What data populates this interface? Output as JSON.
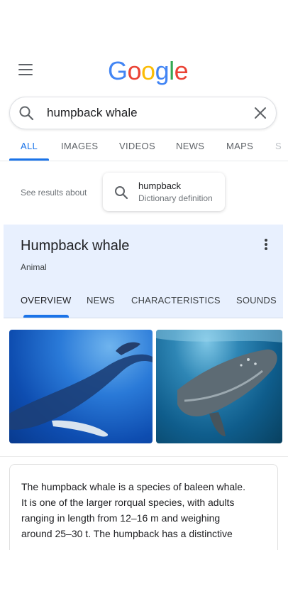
{
  "header": {
    "logo_letters": [
      {
        "char": "G",
        "color": "#4285F4"
      },
      {
        "char": "o",
        "color": "#EA4335"
      },
      {
        "char": "o",
        "color": "#FBBC05"
      },
      {
        "char": "g",
        "color": "#4285F4"
      },
      {
        "char": "l",
        "color": "#34A853"
      },
      {
        "char": "e",
        "color": "#EA4335"
      }
    ],
    "menu_icon": "hamburger-menu-icon"
  },
  "search": {
    "query": "humpback whale",
    "search_icon": "search-icon",
    "clear_icon": "close-icon"
  },
  "tabs": [
    {
      "label": "ALL",
      "active": true
    },
    {
      "label": "IMAGES",
      "active": false
    },
    {
      "label": "VIDEOS",
      "active": false
    },
    {
      "label": "NEWS",
      "active": false
    },
    {
      "label": "MAPS",
      "active": false
    },
    {
      "label": "S",
      "active": false
    }
  ],
  "see_results": {
    "label": "See results about",
    "card_title": "humpback",
    "card_subtitle": "Dictionary definition"
  },
  "knowledge_panel": {
    "title": "Humpback whale",
    "subtitle": "Animal",
    "tabs": [
      {
        "label": "OVERVIEW",
        "active": true
      },
      {
        "label": "NEWS",
        "active": false
      },
      {
        "label": "CHARACTERISTICS",
        "active": false
      },
      {
        "label": "SOUNDS",
        "active": false
      }
    ]
  },
  "description": {
    "lines": [
      "The humpback whale is a species of baleen whale.",
      "It is one of the larger rorqual species, with adults",
      "ranging in length from 12–16 m and weighing",
      "around 25–30 t. The humpback has a distinctive"
    ]
  },
  "colors": {
    "accent": "#1a73e8",
    "panel_bg": "#e8f0fe"
  }
}
